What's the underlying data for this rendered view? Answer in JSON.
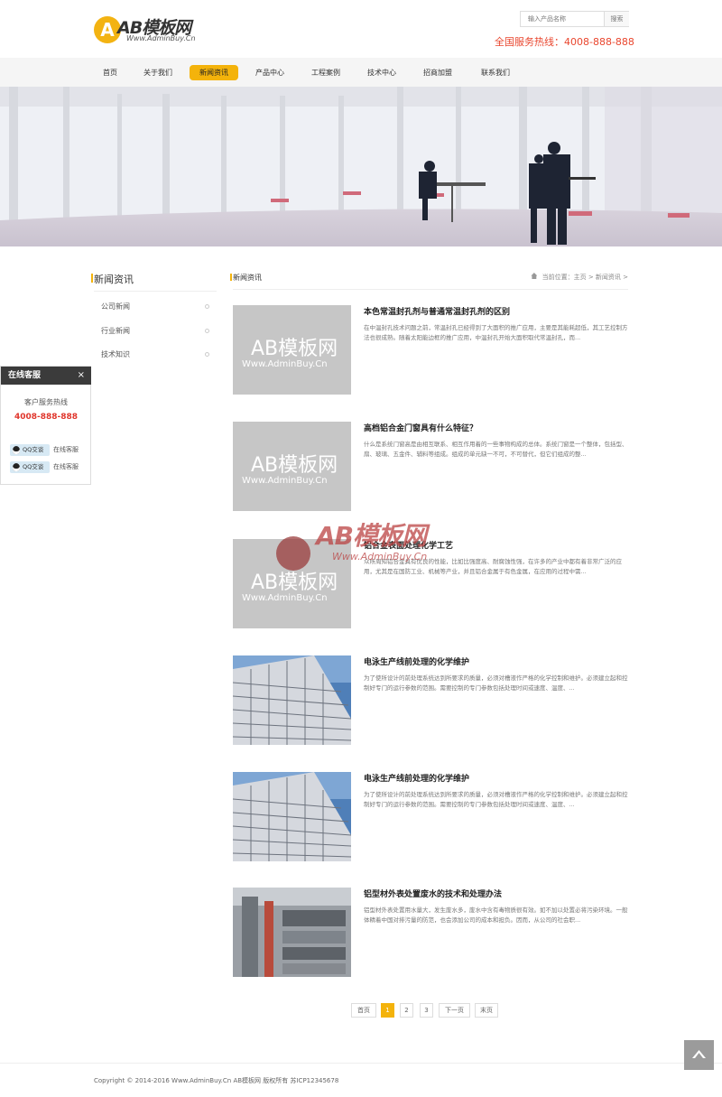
{
  "header": {
    "logo_mark": "A",
    "logo_text": "AB模板网",
    "logo_sub": "Www.AdminBuy.Cn",
    "search_placeholder": "输入产品名称",
    "search_button": "搜索",
    "hotline": "全国服务热线：4008-888-888"
  },
  "nav": {
    "items": [
      {
        "label": "首页",
        "active": false
      },
      {
        "label": "关于我们",
        "active": false
      },
      {
        "label": "新闻资讯",
        "active": true
      },
      {
        "label": "产品中心",
        "active": false
      },
      {
        "label": "工程案例",
        "active": false
      },
      {
        "label": "技术中心",
        "active": false
      },
      {
        "label": "招商加盟",
        "active": false
      },
      {
        "label": "联系我们",
        "active": false
      }
    ]
  },
  "sidebar": {
    "title": "新闻资讯",
    "items": [
      {
        "label": "公司新闻"
      },
      {
        "label": "行业新闻"
      },
      {
        "label": "技术知识"
      }
    ]
  },
  "main": {
    "title": "新闻资讯",
    "breadcrumb": "当前位置：主页 > 新闻资讯 >",
    "placeholder_big": "AB模板网",
    "placeholder_small": "Www.AdminBuy.Cn",
    "articles": [
      {
        "title": "本色常温封孔剂与普通常温封孔剂的区别",
        "summary": "在中温封孔技术问题之前，常温封孔已经得到了大面积的推广应用，主要是其能耗超低，其工艺控制方法也很成熟。随着太阳能边框的推广应用，中温封孔开始大面积取代常温封孔，而...",
        "image": "placeholder"
      },
      {
        "title": "高档铝合金门窗具有什么特征？",
        "summary": "什么是系统门窗高是由相互联系、相互作用着的一些事物构成的总体。系统门窗是一个整体，包括型、扇、玻璃、五金件、辅料等组成。组成的单元缺一不可，不可替代，但它们组成的整...",
        "image": "placeholder"
      },
      {
        "title": "铝合金表面处理化学工艺",
        "summary": "众所周知铝合金具有优良的性能，比如比强度高、耐腐蚀性强，在许多的产业中都有着非常广泛的应用，尤其是在国防工业、机械等产业，并且铝合金属于有色金属，在应用的过程中需...",
        "image": "placeholder"
      },
      {
        "title": "电泳生产线前处理的化学维护",
        "summary": "为了使所设计的前处理系统达到所要求的质量，必须对槽液作严格的化学控制和维护。必须建立起和控制好专门的运行参数的范围。需要控制的专门参数包括处理时间或速度、温度、...",
        "image": "building"
      },
      {
        "title": "电泳生产线前处理的化学维护",
        "summary": "为了使所设计的前处理系统达到所要求的质量，必须对槽液作严格的化学控制和维护。必须建立起和控制好专门的运行参数的范围。需要控制的专门参数包括处理时间或速度、温度、...",
        "image": "building"
      },
      {
        "title": "铝型材外表处置废水的技术和处理办法",
        "summary": "铝型材外表处置用水量大，发生废水多，废水中含有毒物质很有效。如不加以处置必将污染环境。一般体精着中国对排污量的防范，也会添加公司的成本和担负。因而，从公司的社会职...",
        "image": "factory"
      }
    ]
  },
  "pager": {
    "first": "首页",
    "pages": [
      "1",
      "2",
      "3"
    ],
    "next": "下一页",
    "last": "末页"
  },
  "service": {
    "title": "在线客服",
    "close": "×",
    "hotline_label": "客户服务热线",
    "hotline": "4008-888-888",
    "qq_button": "QQ交谈",
    "qq_status": "在线客服"
  },
  "watermark": {
    "text": "AB模板网",
    "sub": "Www.AdminBuy.Cn"
  },
  "footer": {
    "text": "Copyright © 2014-2016 Www.AdminBuy.Cn AB模板网 版权所有   苏ICP12345678"
  },
  "colors": {
    "accent": "#f4b30b",
    "hotline": "#e9462e"
  }
}
